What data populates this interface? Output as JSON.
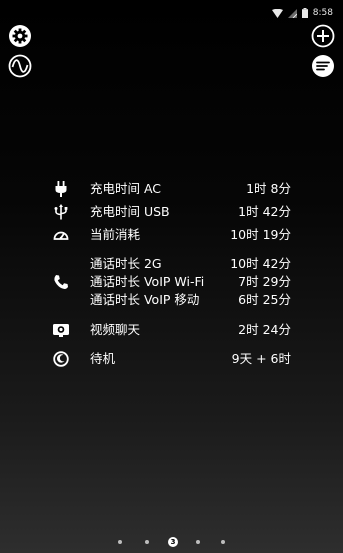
{
  "status_bar": {
    "time": "8:58"
  },
  "stats": [
    {
      "icon": "plug-icon",
      "label": "充电时间 AC",
      "value": "1时 8分"
    },
    {
      "icon": "usb-icon",
      "label": "充电时间 USB",
      "value": "1时 42分"
    },
    {
      "icon": "gauge-icon",
      "label": "当前消耗",
      "value": "10时 19分"
    },
    {
      "icon": "phone-icon",
      "label": "通话时长 2G",
      "value": "10时 42分"
    },
    {
      "icon": null,
      "label": "通话时长 VoIP Wi-Fi",
      "value": "7时 29分"
    },
    {
      "icon": null,
      "label": "通话时长 VoIP 移动",
      "value": "6时 25分"
    },
    {
      "icon": "video-chat-icon",
      "label": "视频聊天",
      "value": "2时 24分"
    },
    {
      "icon": "standby-icon",
      "label": "待机",
      "value": "9天 + 6时"
    }
  ],
  "pager": {
    "page_count": 5,
    "current_page": "3"
  }
}
